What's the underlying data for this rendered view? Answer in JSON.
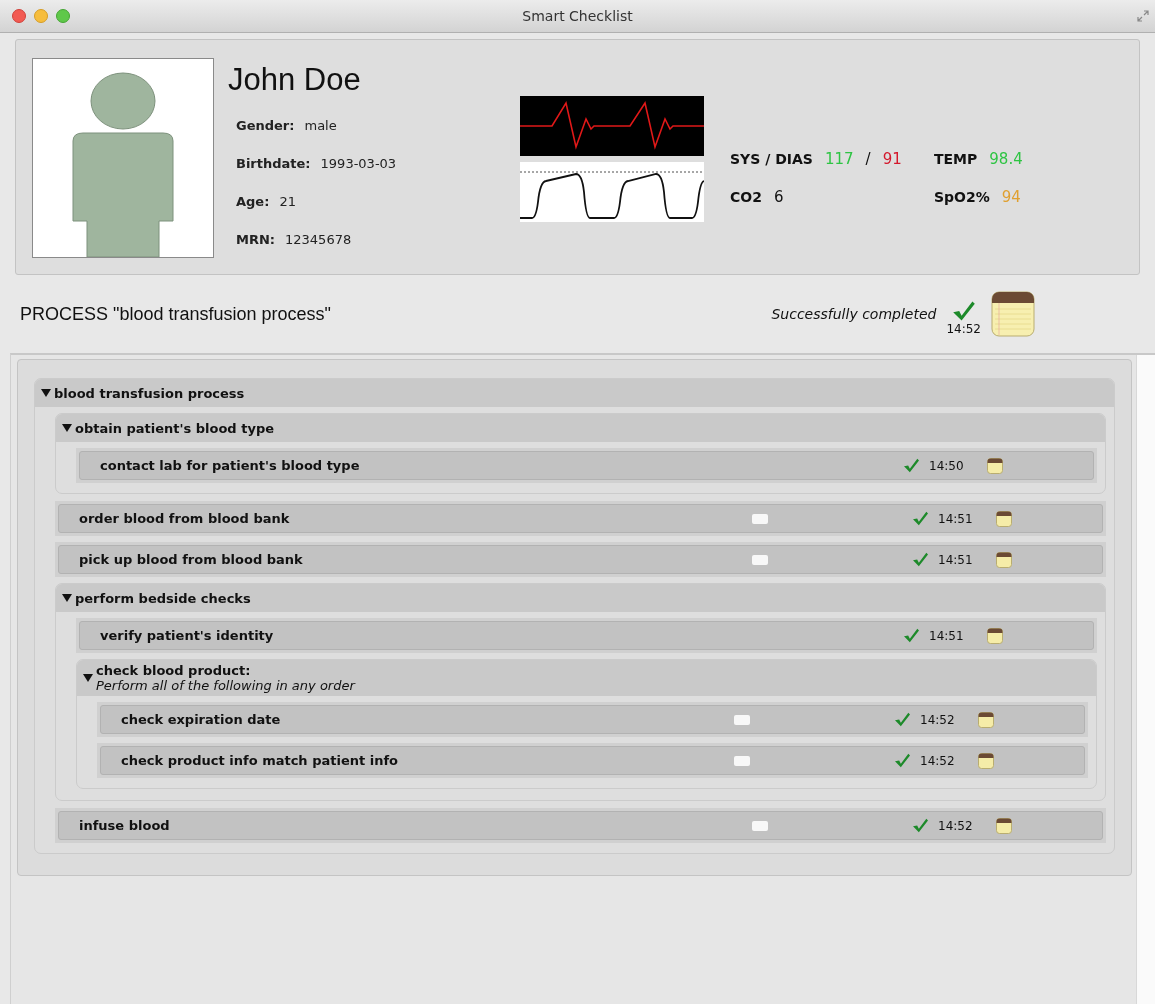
{
  "window": {
    "title": "Smart Checklist"
  },
  "patient": {
    "name": "John Doe",
    "fields": [
      {
        "label": "Gender:",
        "value": "male"
      },
      {
        "label": "Birthdate:",
        "value": "1993-03-03"
      },
      {
        "label": "Age:",
        "value": "21"
      },
      {
        "label": "MRN:",
        "value": "12345678"
      }
    ]
  },
  "vitals": [
    {
      "label": "SYS / DIAS",
      "parts": [
        {
          "text": "117",
          "color": "#2ec443"
        },
        {
          "text": "/",
          "color": "#111111"
        },
        {
          "text": "91",
          "color": "#d4182c"
        }
      ]
    },
    {
      "label": "TEMP",
      "parts": [
        {
          "text": "98.4",
          "color": "#2ec443"
        }
      ]
    },
    {
      "label": "CO2",
      "parts": [
        {
          "text": "6",
          "color": "#111111"
        }
      ]
    },
    {
      "label": "SpO2%",
      "parts": [
        {
          "text": "94",
          "color": "#e0a030"
        }
      ]
    }
  ],
  "process": {
    "title": "PROCESS \"blood transfusion process\"",
    "status": "Successfully completed",
    "done": true,
    "time": "14:52"
  },
  "tree": [
    {
      "kind": "group",
      "title": "blood transfusion process",
      "expanded": true,
      "children": [
        {
          "kind": "group",
          "title": "obtain patient's blood type",
          "expanded": true,
          "children": [
            {
              "kind": "task",
              "title": "contact lab for patient's blood type",
              "marker": false,
              "done": true,
              "time": "14:50"
            }
          ]
        },
        {
          "kind": "task",
          "title": "order blood from blood bank",
          "marker": true,
          "done": true,
          "time": "14:51"
        },
        {
          "kind": "task",
          "title": "pick up blood from blood bank",
          "marker": true,
          "done": true,
          "time": "14:51"
        },
        {
          "kind": "group",
          "title": "perform bedside checks",
          "expanded": true,
          "children": [
            {
              "kind": "task",
              "title": "verify patient's identity",
              "marker": false,
              "done": true,
              "time": "14:51"
            },
            {
              "kind": "group",
              "title": "check blood product:",
              "subtitle": "Perform all of the following in any order",
              "expanded": true,
              "children": [
                {
                  "kind": "task",
                  "title": "check expiration date",
                  "marker": true,
                  "done": true,
                  "time": "14:52"
                },
                {
                  "kind": "task",
                  "title": "check product info match patient info",
                  "marker": true,
                  "done": true,
                  "time": "14:52"
                }
              ]
            }
          ]
        },
        {
          "kind": "task",
          "title": "infuse blood",
          "marker": true,
          "done": true,
          "time": "14:52"
        }
      ]
    }
  ]
}
